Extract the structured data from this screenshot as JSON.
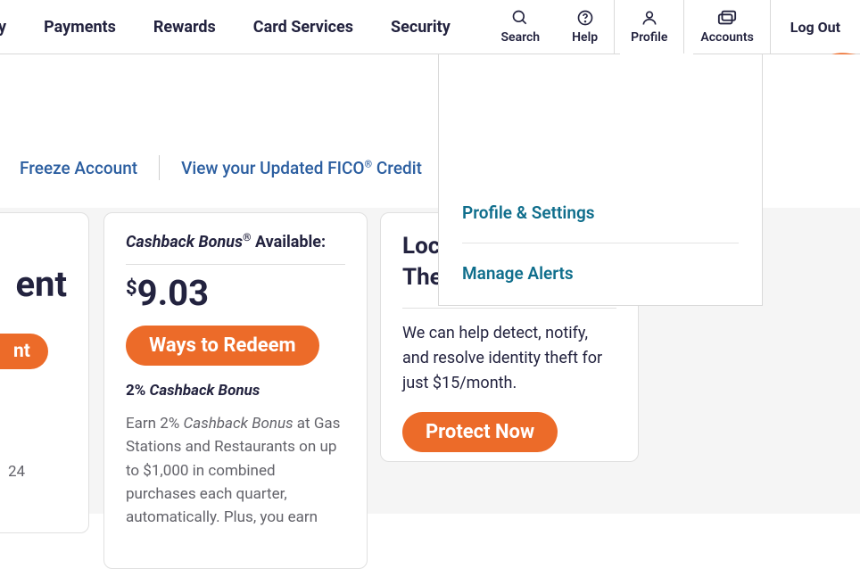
{
  "topnav": {
    "truncated": "y",
    "items": [
      "Payments",
      "Rewards",
      "Card Services",
      "Security"
    ],
    "utilities": {
      "search": "Search",
      "help": "Help",
      "profile": "Profile",
      "accounts": "Accounts"
    },
    "logout": "Log Out"
  },
  "links": {
    "freeze": "Freeze Account",
    "fico_prefix": "View your Updated FICO",
    "fico_suffix": " Credit"
  },
  "card_left": {
    "big_suffix": "ent",
    "pill_suffix": "nt",
    "small": "24"
  },
  "card_mid": {
    "title_ital": "Cashback Bonus",
    "title_rest": " Available:",
    "amount_prefix": "$",
    "amount": "9.03",
    "redeem": "Ways to Redeem",
    "sub_pct": "2% ",
    "sub_ital": "Cashback Bonus",
    "body_a": "Earn 2% ",
    "body_ital": "Cashback Bonus",
    "body_b": " at Gas Stations and Restaurants on up to $1,000 in combined purchases each quarter, automatically. Plus, you earn"
  },
  "card_right": {
    "title": "Lock\nTheft",
    "title_line1": "Lock",
    "title_line2": "Theft",
    "body": "We can help detect, notify, and resolve identity theft for just $15/month.",
    "cta": "Protect Now"
  },
  "dropdown": {
    "link1": "Profile & Settings",
    "link2": "Manage Alerts"
  }
}
